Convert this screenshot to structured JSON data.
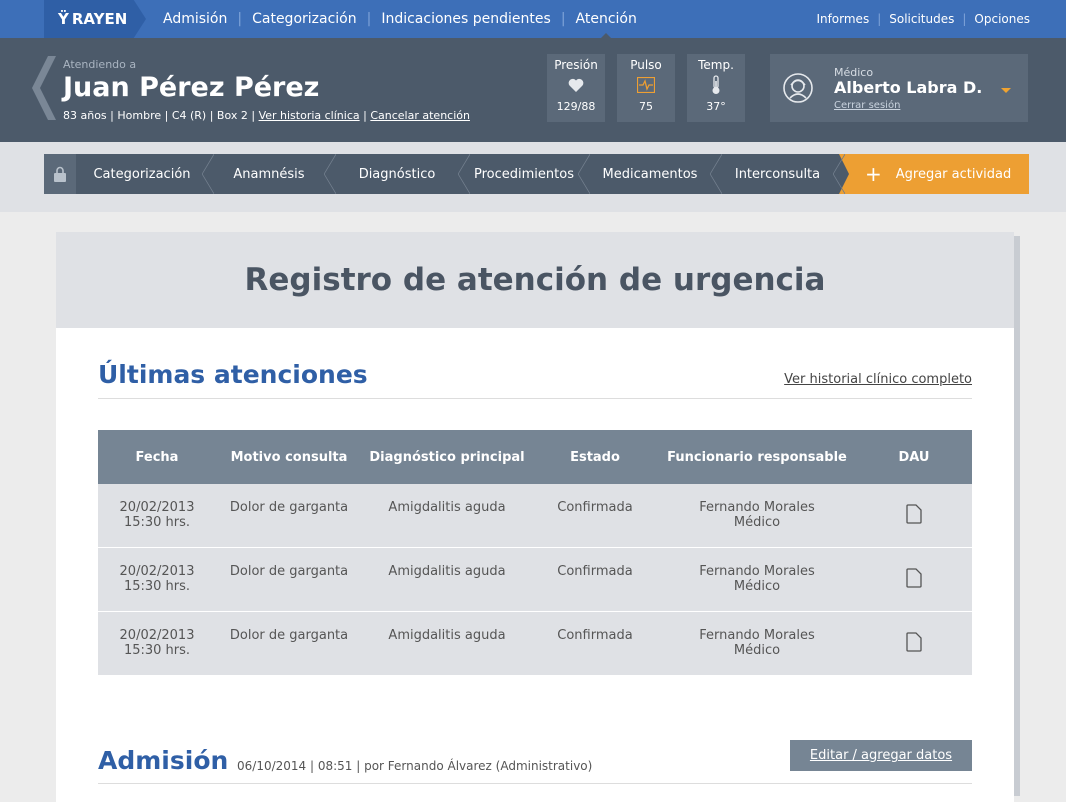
{
  "topnav": {
    "logo": "RAYEN",
    "items": [
      "Admisión",
      "Categorización",
      "Indicaciones pendientes",
      "Atención"
    ],
    "active_item": "Atención",
    "right_items": [
      "Informes",
      "Solicitudes",
      "Opciones"
    ]
  },
  "patient": {
    "attending_label": "Atendiendo a",
    "name": "Juan Pérez Pérez",
    "info": "83 años | Hombre | C4 (R) | Box 2 |",
    "history_link": "Ver historia clínica",
    "cancel_link": "Cancelar atención",
    "info_sep": "|"
  },
  "vitals": [
    {
      "label": "Presión",
      "icon": "heart-icon",
      "value": "129/88"
    },
    {
      "label": "Pulso",
      "icon": "pulse-icon",
      "value": "75"
    },
    {
      "label": "Temp.",
      "icon": "thermometer-icon",
      "value": "37°"
    }
  ],
  "doctor": {
    "label": "Médico",
    "name": "Alberto Labra D.",
    "logout": "Cerrar sesión",
    "icon": "doctor-avatar-icon"
  },
  "steps": [
    "Categorización",
    "Anamnésis",
    "Diagnóstico",
    "Procedimientos",
    "Medicamentos",
    "Interconsulta"
  ],
  "add_activity": "Agregar actividad",
  "colors": {
    "primary": "#3d6fb8",
    "header": "#4c5a6a",
    "accent": "#ed9f33",
    "title_blue": "#2f5fa6"
  },
  "card": {
    "title": "Registro de atención de urgencia"
  },
  "last_visits": {
    "title": "Últimas atenciones",
    "history_link": "Ver historial clínico completo",
    "columns": [
      "Fecha",
      "Motivo consulta",
      "Diagnóstico principal",
      "Estado",
      "Funcionario responsable",
      "DAU"
    ],
    "rows": [
      {
        "date": "20/02/2013",
        "time": "15:30 hrs.",
        "reason": "Dolor de garganta",
        "diagnosis": "Amigdalitis aguda",
        "status": "Confirmada",
        "staff": "Fernando Morales",
        "role": "Médico"
      },
      {
        "date": "20/02/2013",
        "time": "15:30 hrs.",
        "reason": "Dolor de garganta",
        "diagnosis": "Amigdalitis aguda",
        "status": "Confirmada",
        "staff": "Fernando Morales",
        "role": "Médico"
      },
      {
        "date": "20/02/2013",
        "time": "15:30 hrs.",
        "reason": "Dolor de garganta",
        "diagnosis": "Amigdalitis aguda",
        "status": "Confirmada",
        "staff": "Fernando Morales",
        "role": "Médico"
      }
    ]
  },
  "admission": {
    "title": "Admisión",
    "meta": "06/10/2014 | 08:51 | por Fernando Álvarez (Administrativo)",
    "edit_button": "Editar / agregar datos"
  }
}
